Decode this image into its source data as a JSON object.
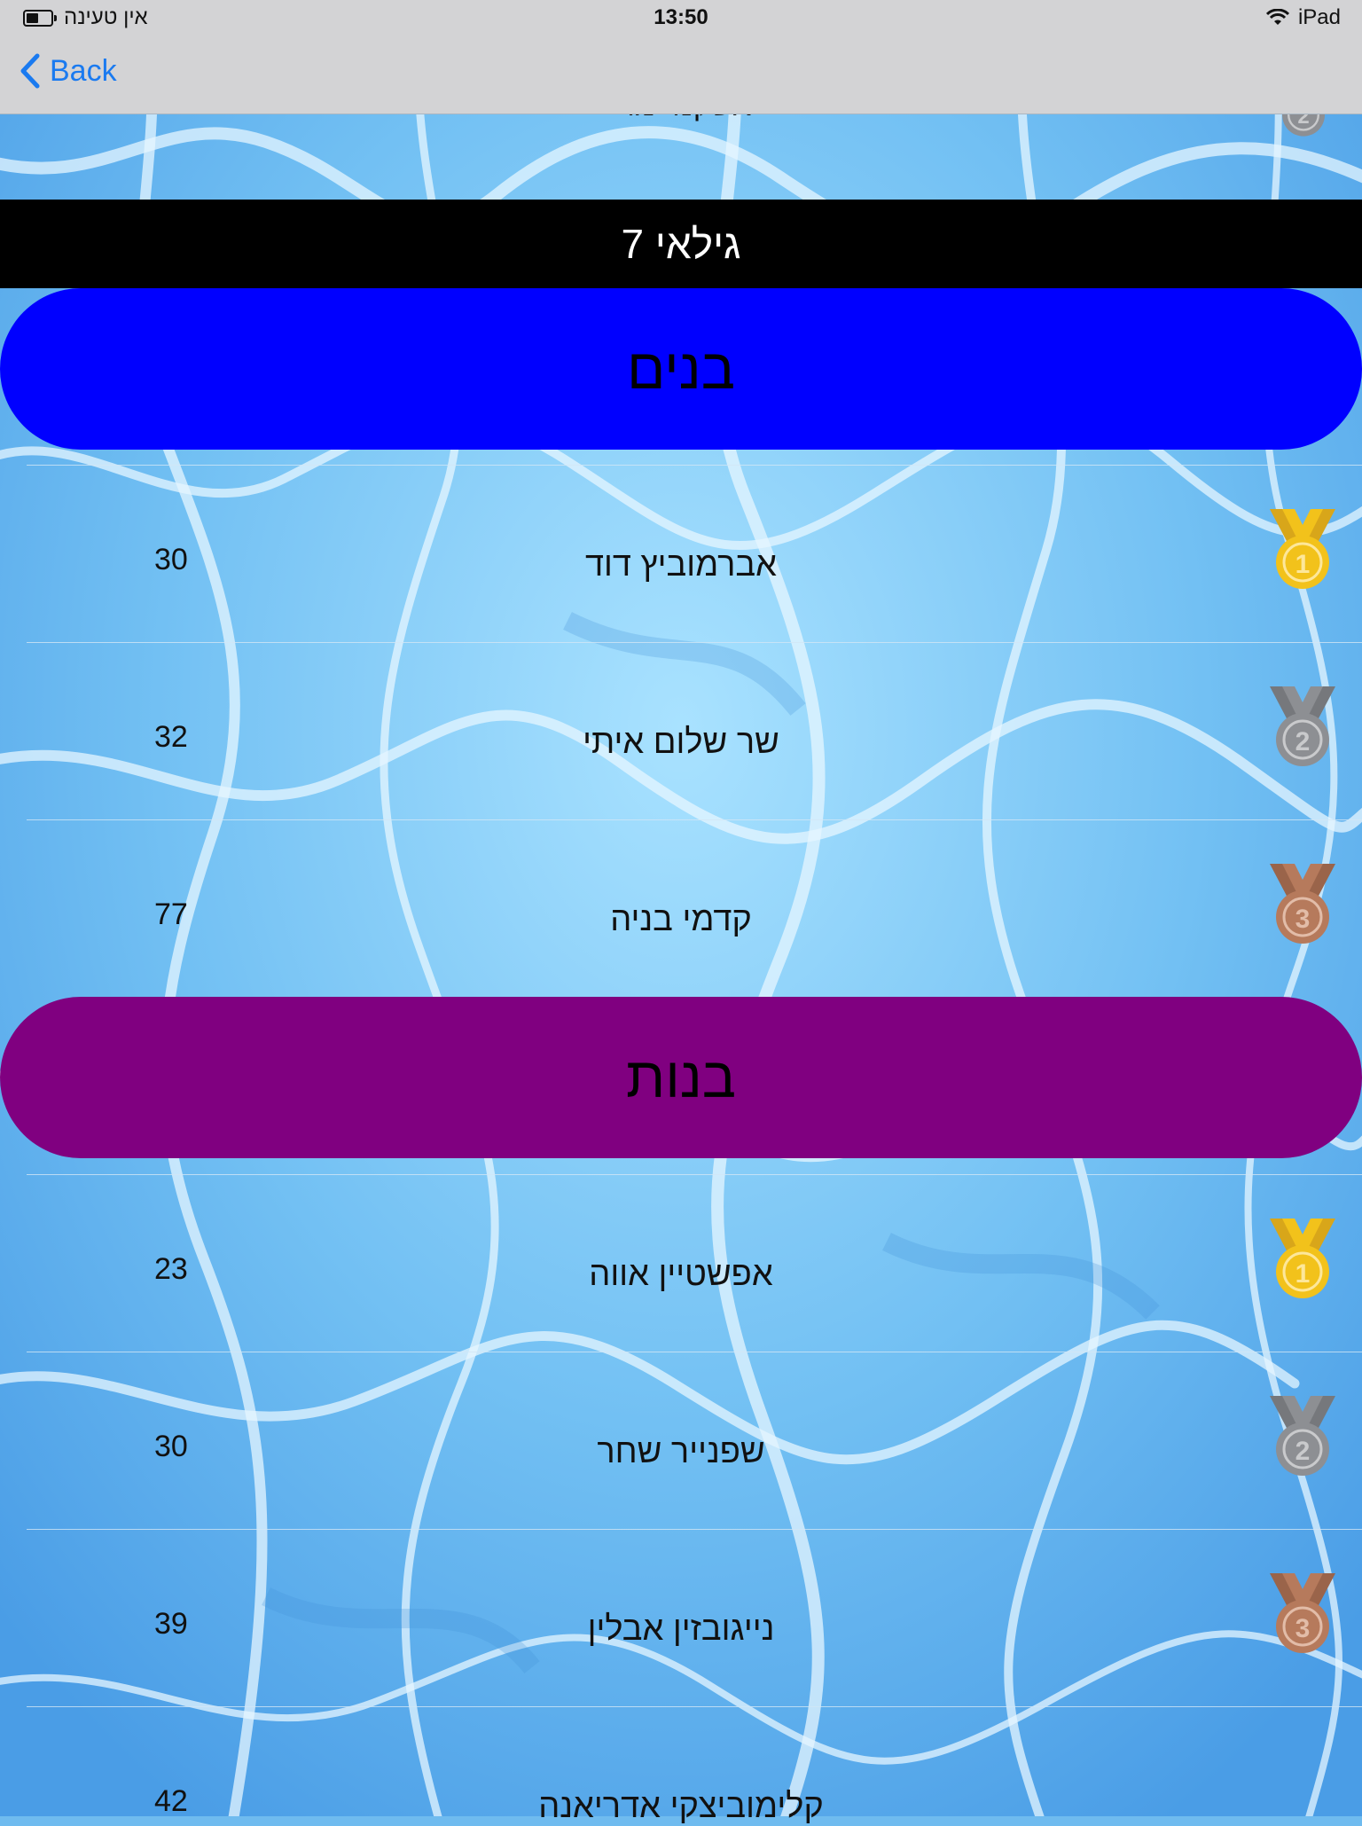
{
  "status_bar": {
    "carrier_text": "אין טעינה",
    "time": "13:50",
    "device": "iPad",
    "icons": [
      "battery-icon",
      "wifi-icon"
    ]
  },
  "nav": {
    "back_label": "Back"
  },
  "previous_row": {
    "name": "אשקנזי מרי",
    "medal": "2"
  },
  "age_group": {
    "title": "גילאי 7"
  },
  "sections": [
    {
      "title": "בנים",
      "color": "#0000ff",
      "rows": [
        {
          "name": "אברמוביץ דוד",
          "score": "30",
          "medal": "1"
        },
        {
          "name": "שר שלום איתי",
          "score": "32",
          "medal": "2"
        },
        {
          "name": "קדמי בניה",
          "score": "77",
          "medal": "3"
        }
      ]
    },
    {
      "title": "בנות",
      "color": "#800080",
      "rows": [
        {
          "name": "אפשטיין אווה",
          "score": "23",
          "medal": "1"
        },
        {
          "name": "שפנייר שחר",
          "score": "30",
          "medal": "2"
        },
        {
          "name": "נייגובזין אבלין",
          "score": "39",
          "medal": "3"
        },
        {
          "name": "קלימוביצקי אדריאנה",
          "score": "42",
          "medal": ""
        }
      ]
    }
  ],
  "colors": {
    "gold": "#f2c21b",
    "silver": "#8d8f93",
    "bronze": "#b67a5c",
    "nav_tint": "#1a7af0"
  }
}
